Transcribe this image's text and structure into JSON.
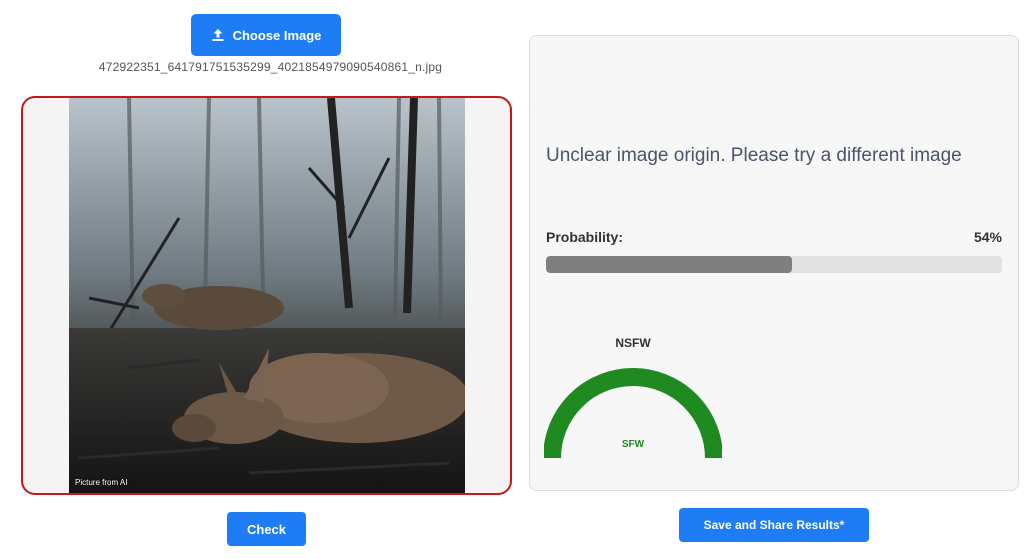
{
  "upload": {
    "button_label": "Choose Image",
    "button_icon": "upload-icon",
    "filename": "472922351_641791751535299_4021854979090540861_n.jpg"
  },
  "preview": {
    "caption": "Picture from AI",
    "border_color": "#c8171c"
  },
  "actions": {
    "check_label": "Check",
    "share_label": "Save and Share Results*"
  },
  "result": {
    "message": "Unclear image origin. Please try a different image",
    "probability_label": "Probability:",
    "probability_value": "54%",
    "probability_fraction": 0.54
  },
  "gauge": {
    "top_label": "NSFW",
    "bottom_label": "SFW",
    "color": "#1f8a1f"
  },
  "colors": {
    "primary": "#1e7cf5",
    "bar_fill": "#7f7f7f",
    "bar_track": "#e2e2e2"
  }
}
